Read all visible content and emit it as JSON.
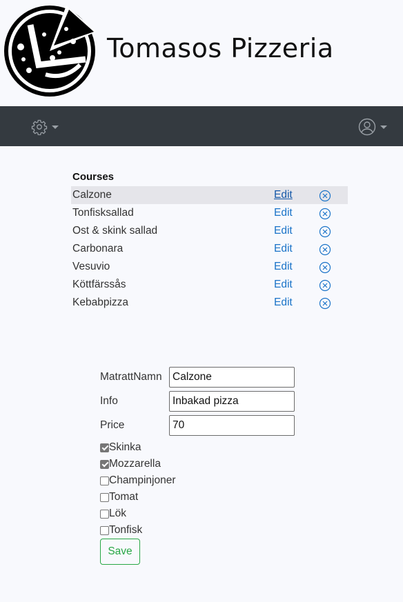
{
  "brand": {
    "title": "Tomasos Pizzeria"
  },
  "navbar": {
    "settings_icon": "gear-icon",
    "user_icon": "user-circle-icon",
    "background": "#343a40"
  },
  "courses": {
    "title": "Courses",
    "edit_label": "Edit",
    "delete_icon": "circle-x-icon",
    "items": [
      {
        "name": "Calzone",
        "active": true
      },
      {
        "name": "Tonfisksallad"
      },
      {
        "name": "Ost & skink sallad"
      },
      {
        "name": "Carbonara"
      },
      {
        "name": "Vesuvio"
      },
      {
        "name": "Köttfärssås"
      },
      {
        "name": "Kebabpizza"
      }
    ]
  },
  "form": {
    "name_label": "MatrattNamn",
    "name_value": "Calzone",
    "info_label": "Info",
    "info_value": "Inbakad pizza",
    "price_label": "Price",
    "price_value": "70",
    "ingredients": [
      {
        "label": "Skinka",
        "checked": true
      },
      {
        "label": "Mozzarella",
        "checked": true
      },
      {
        "label": "Champinjoner",
        "checked": false
      },
      {
        "label": "Tomat",
        "checked": false
      },
      {
        "label": "Lök",
        "checked": false
      },
      {
        "label": "Tonfisk",
        "checked": false
      }
    ],
    "save_label": "Save"
  },
  "colors": {
    "accent_link": "#1a73c8",
    "save_green": "#28a745"
  }
}
